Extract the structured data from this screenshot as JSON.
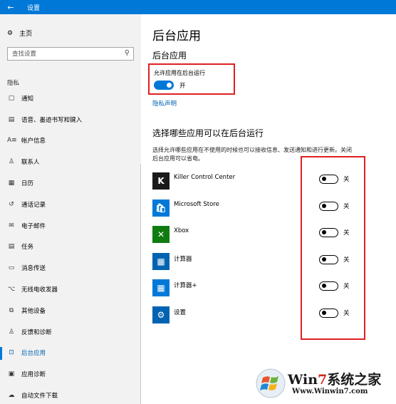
{
  "window": {
    "title": "设置",
    "back_icon": "←"
  },
  "sidebar": {
    "home_label": "主页",
    "home_icon": "⚙",
    "search_placeholder": "查找设置",
    "search_icon": "⚲",
    "section": "隐私",
    "items": [
      {
        "label": "通知",
        "icon": "▢",
        "name": "notifications"
      },
      {
        "label": "语音、墨迹书写和键入",
        "icon": "▤",
        "name": "speech"
      },
      {
        "label": "帐户信息",
        "icon": "A≡",
        "name": "account-info"
      },
      {
        "label": "联系人",
        "icon": "♙",
        "name": "contacts"
      },
      {
        "label": "日历",
        "icon": "▦",
        "name": "calendar"
      },
      {
        "label": "通话记录",
        "icon": "↺",
        "name": "call-history"
      },
      {
        "label": "电子邮件",
        "icon": "✉",
        "name": "email"
      },
      {
        "label": "任务",
        "icon": "▤",
        "name": "tasks"
      },
      {
        "label": "消息传送",
        "icon": "▭",
        "name": "messaging"
      },
      {
        "label": "无线电收发器",
        "icon": "⌥",
        "name": "radios"
      },
      {
        "label": "其他设备",
        "icon": "⧉",
        "name": "other-devices"
      },
      {
        "label": "反馈和诊断",
        "icon": "♙",
        "name": "feedback"
      },
      {
        "label": "后台应用",
        "icon": "⊡",
        "name": "background-apps",
        "active": true
      },
      {
        "label": "应用诊断",
        "icon": "▣",
        "name": "app-diagnostics"
      },
      {
        "label": "自动文件下载",
        "icon": "☁",
        "name": "auto-download"
      }
    ]
  },
  "main": {
    "title": "后台应用",
    "subtitle": "后台应用",
    "allow_label": "允许应用在后台运行",
    "allow_state": "开",
    "allow_on": true,
    "privacy_link": "隐私声明",
    "choose_title": "选择哪些应用可以在后台运行",
    "description": "选择允许哪些应用在不使用的时候也可以接收信息、发送通知和进行更新。关闭后台应用可以省电。",
    "apps": [
      {
        "name": "Killer Control Center",
        "state": "关",
        "on": false,
        "icon_bg": "#1a1a1a",
        "icon_glyph": "K"
      },
      {
        "name": "Microsoft Store",
        "state": "关",
        "on": false,
        "icon_bg": "#0078d7",
        "icon_glyph": "🛍"
      },
      {
        "name": "Xbox",
        "state": "关",
        "on": false,
        "icon_bg": "#107c10",
        "icon_glyph": "✕"
      },
      {
        "name": "计算器",
        "state": "关",
        "on": false,
        "icon_bg": "#0063b1",
        "icon_glyph": "▦"
      },
      {
        "name": "计算器+",
        "state": "关",
        "on": false,
        "icon_bg": "#0078d7",
        "icon_glyph": "▦"
      },
      {
        "name": "设置",
        "state": "关",
        "on": false,
        "icon_bg": "#0063b1",
        "icon_glyph": "⚙"
      }
    ]
  },
  "watermark": {
    "brand_prefix": "Win",
    "brand_number": "7",
    "brand_suffix": "系统之家",
    "url": "Www.Winwin7.com"
  },
  "colors": {
    "accent": "#0078d7",
    "highlight_box": "#e02020"
  }
}
